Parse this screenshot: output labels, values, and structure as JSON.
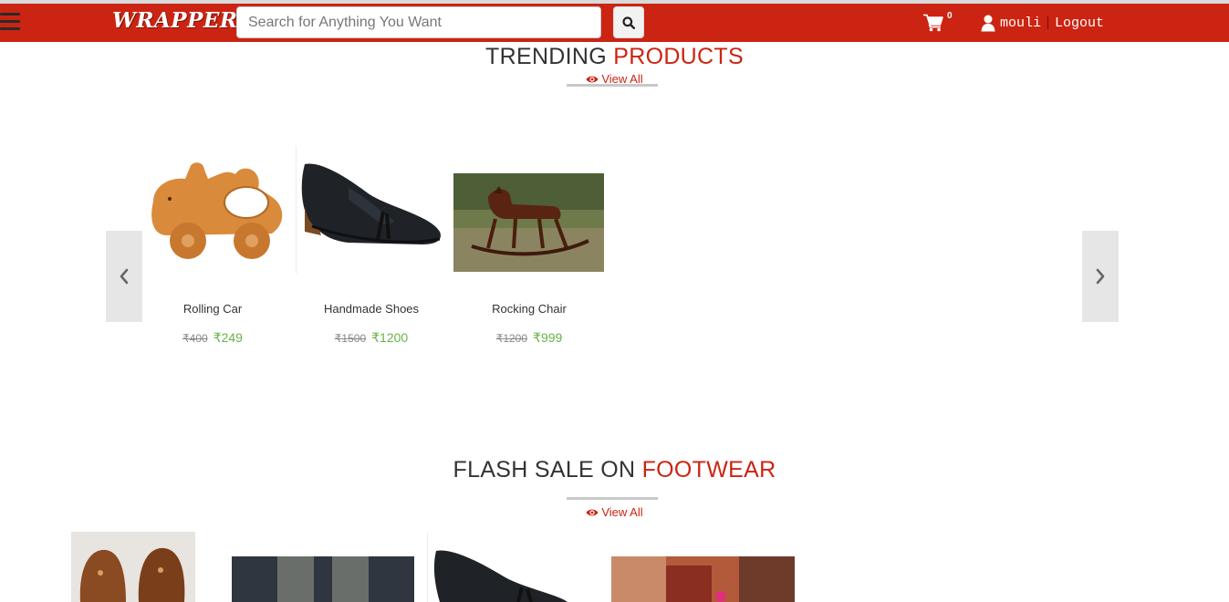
{
  "header": {
    "logo": "WRAPPERS",
    "search_placeholder": "Search for Anything You Want",
    "cart_count": "0",
    "username": "mouli",
    "separator": "|",
    "logout": "Logout"
  },
  "trending": {
    "title_plain": "TRENDING ",
    "title_highlight": "PRODUCTS",
    "view_all": "View All",
    "products": [
      {
        "name": "Rolling Car",
        "old_price": "₹400",
        "new_price": "₹249"
      },
      {
        "name": "Handmade Shoes",
        "old_price": "₹1500",
        "new_price": "₹1200"
      },
      {
        "name": "Rocking Chair",
        "old_price": "₹1200",
        "new_price": "₹999"
      }
    ]
  },
  "flash": {
    "title_plain": "FLASH SALE ON ",
    "title_highlight": "FOOTWEAR",
    "view_all": "View All"
  },
  "colors": {
    "brand": "#cc2412",
    "price_new": "#68b346"
  },
  "icons": [
    "menu-icon",
    "search-icon",
    "cart-icon",
    "user-icon",
    "eye-icon",
    "chevron-left-icon",
    "chevron-right-icon"
  ]
}
